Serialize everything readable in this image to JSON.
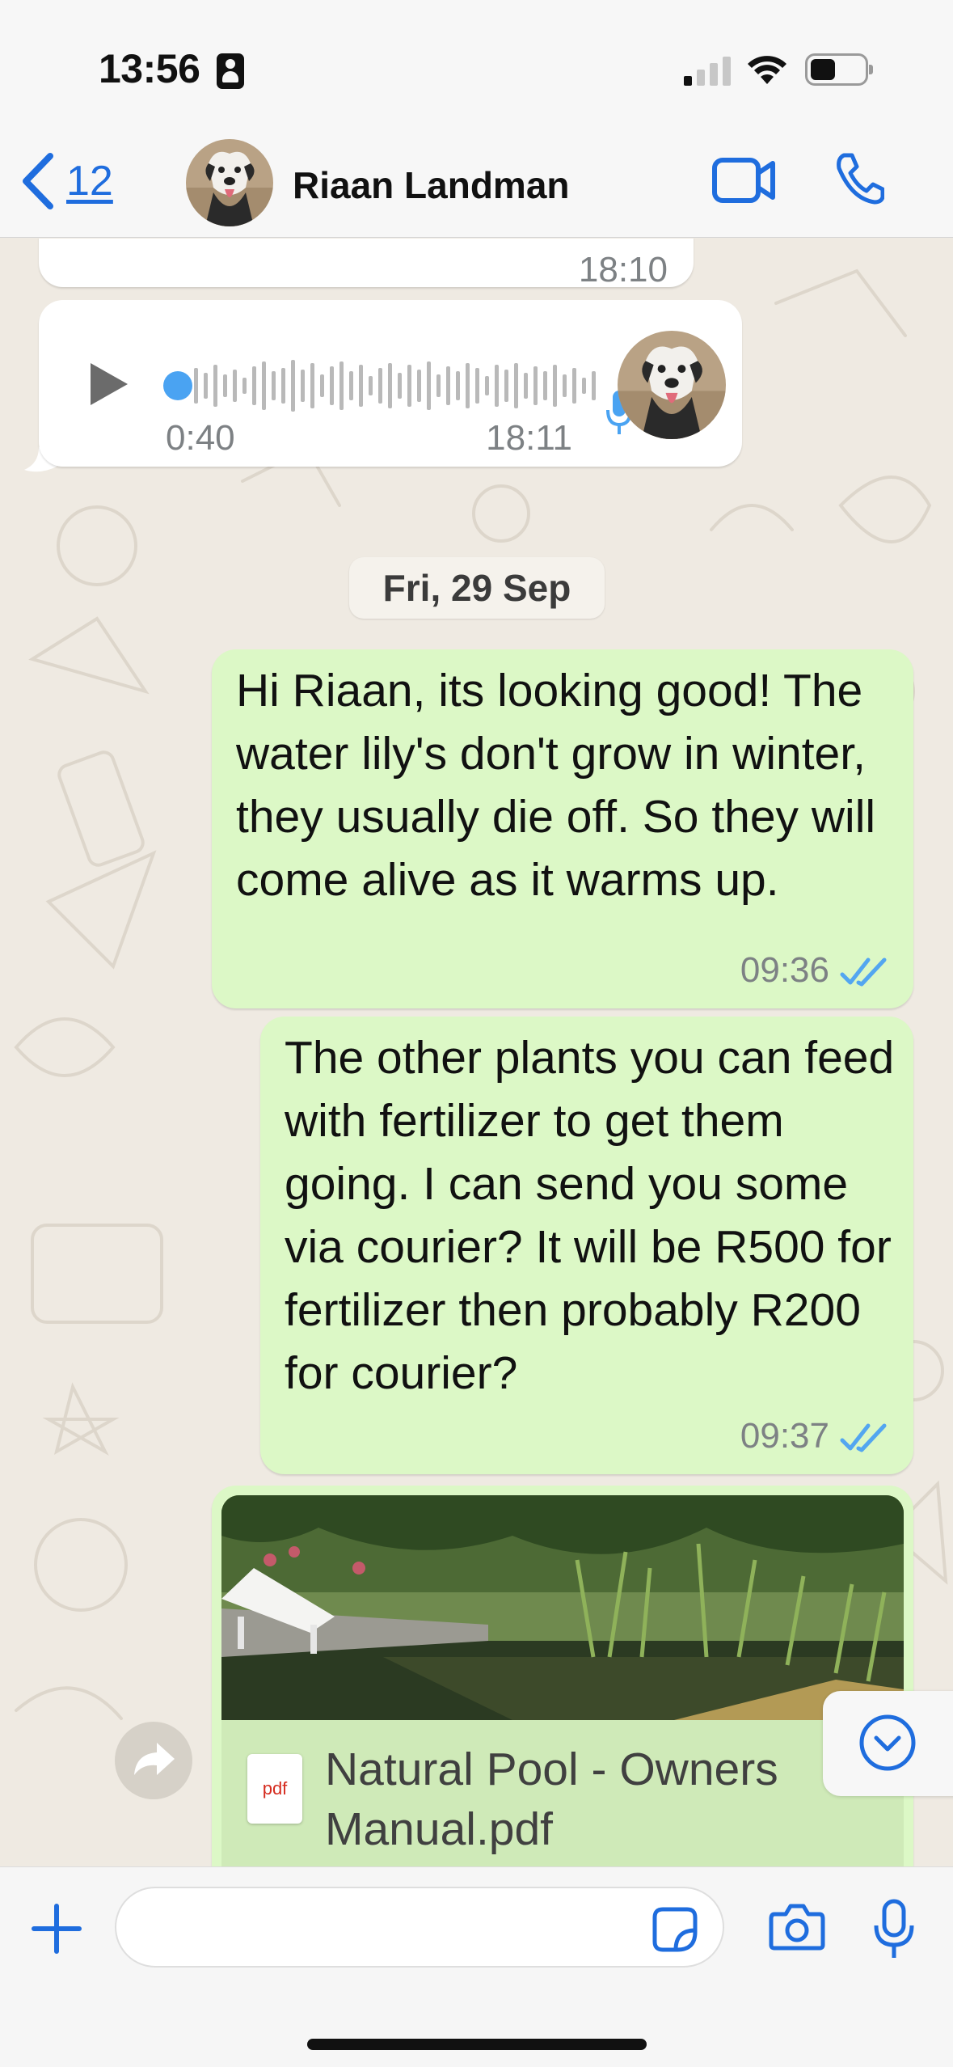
{
  "status_bar": {
    "time": "13:56"
  },
  "header": {
    "back_count": "12",
    "contact_name": "Riaan Landman"
  },
  "messages": {
    "previous": {
      "time": "18:10"
    },
    "voice_note": {
      "duration": "0:40",
      "time": "18:11"
    },
    "date_divider": "Fri, 29 Sep",
    "msg1": {
      "text": "Hi Riaan, its looking good! The water lily's don't grow in winter, they usually die off. So they will come alive as it warms up.",
      "time": "09:36"
    },
    "msg2": {
      "text": "The other plants you can feed with fertilizer to get them going. I can send you some via courier? It will be R500 for fertilizer then probably R200 for courier?",
      "time": "09:37"
    },
    "document": {
      "file_type": "pdf",
      "file_name": "Natural Pool - Owners Manual.pdf"
    }
  },
  "input": {
    "placeholder": ""
  },
  "colors": {
    "accent_blue": "#1f6dde",
    "outgoing_bubble": "#dcf8c6",
    "incoming_bubble": "#ffffff",
    "chat_background": "#efeae2",
    "read_ticks": "#53a6f0"
  },
  "icons": {
    "back": "chevron-left-icon",
    "video_call": "video-camera-icon",
    "voice_call": "phone-icon",
    "play": "play-icon",
    "mic": "microphone-icon",
    "forward": "share-arrow-icon",
    "scroll_down": "chevron-down-circle-icon",
    "attach": "plus-icon",
    "sticker": "sticker-icon",
    "camera": "camera-icon"
  }
}
